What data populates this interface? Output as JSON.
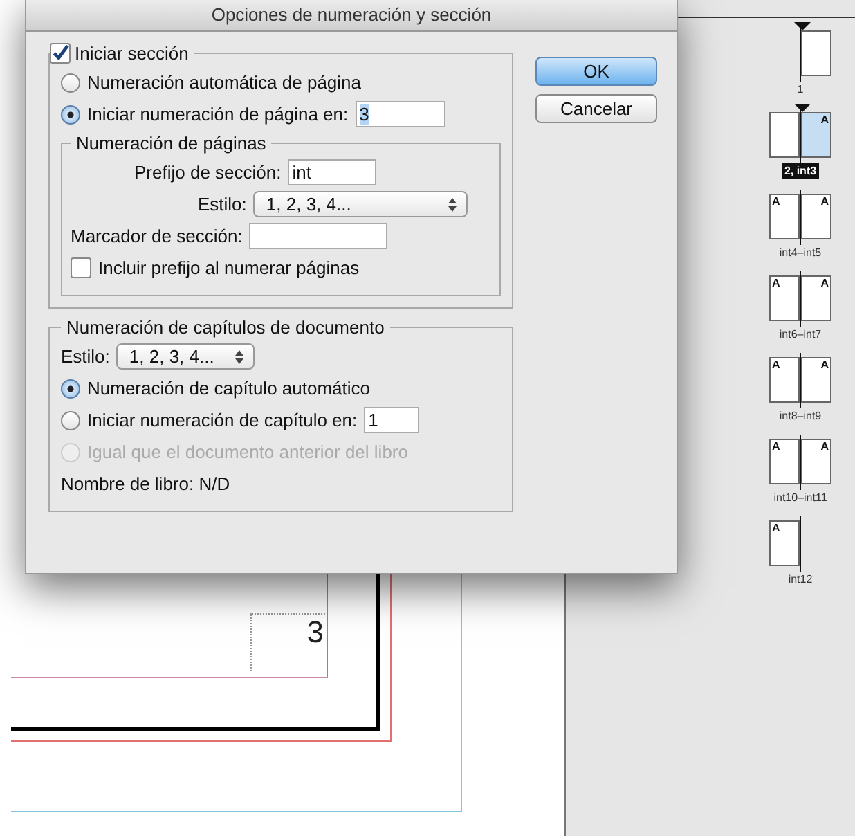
{
  "dialog": {
    "title": "Opciones de numeración y sección",
    "section": {
      "label": "Iniciar sección",
      "checked": true,
      "options": [
        {
          "label": "Numeración automática de página",
          "selected": false
        },
        {
          "label": "Iniciar numeración de página en:",
          "selected": true,
          "value": "3",
          "value_highlighted": true
        }
      ],
      "page_numbering": {
        "title": "Numeración de páginas",
        "prefix_label": "Prefijo de sección:",
        "prefix_value": "int",
        "style_label": "Estilo:",
        "style_value": "1, 2, 3, 4...",
        "marker_label": "Marcador de sección:",
        "include_prefix": {
          "label": "Incluir prefijo al numerar páginas",
          "checked": false
        }
      }
    },
    "chapter": {
      "title": "Numeración de capítulos de documento",
      "style_label": "Estilo:",
      "style_value": "1, 2, 3, 4...",
      "options": [
        {
          "label": "Numeración de capítulo automático",
          "selected": true,
          "disabled": false
        },
        {
          "label": "Iniciar numeración de capítulo en:",
          "selected": false,
          "disabled": false,
          "value": "1"
        },
        {
          "label": "Igual que el documento anterior del libro",
          "selected": false,
          "disabled": true
        }
      ],
      "book_name": "Nombre de libro: N/D"
    },
    "buttons": [
      {
        "label": "OK",
        "default": true
      },
      {
        "label": "Cancelar",
        "default": false
      }
    ]
  },
  "canvas": {
    "page_number": "3"
  },
  "pages_panel": {
    "spreads": [
      {
        "label": "1",
        "selected": false,
        "section_start": true,
        "right_page": {
          "selected": false
        }
      },
      {
        "label": "2, int3",
        "selected": true,
        "section_start": true,
        "left_page": {
          "selected": false
        },
        "right_page": {
          "master": "A",
          "selected": true
        }
      },
      {
        "label": "int4–int5",
        "selected": false,
        "section_start": false,
        "left_page": {
          "master": "A",
          "selected": false
        },
        "right_page": {
          "master": "A",
          "selected": false
        }
      },
      {
        "label": "int6–int7",
        "selected": false,
        "section_start": false,
        "left_page": {
          "master": "A",
          "selected": false
        },
        "right_page": {
          "master": "A",
          "selected": false
        }
      },
      {
        "label": "int8–int9",
        "selected": false,
        "section_start": false,
        "left_page": {
          "master": "A",
          "selected": false
        },
        "right_page": {
          "master": "A",
          "selected": false
        }
      },
      {
        "label": "int10–int11",
        "selected": false,
        "section_start": false,
        "left_page": {
          "master": "A",
          "selected": false
        },
        "right_page": {
          "master": "A",
          "selected": false
        }
      },
      {
        "label": "int12",
        "selected": false,
        "section_start": false,
        "left_page": {
          "master": "A",
          "selected": false
        }
      }
    ]
  }
}
